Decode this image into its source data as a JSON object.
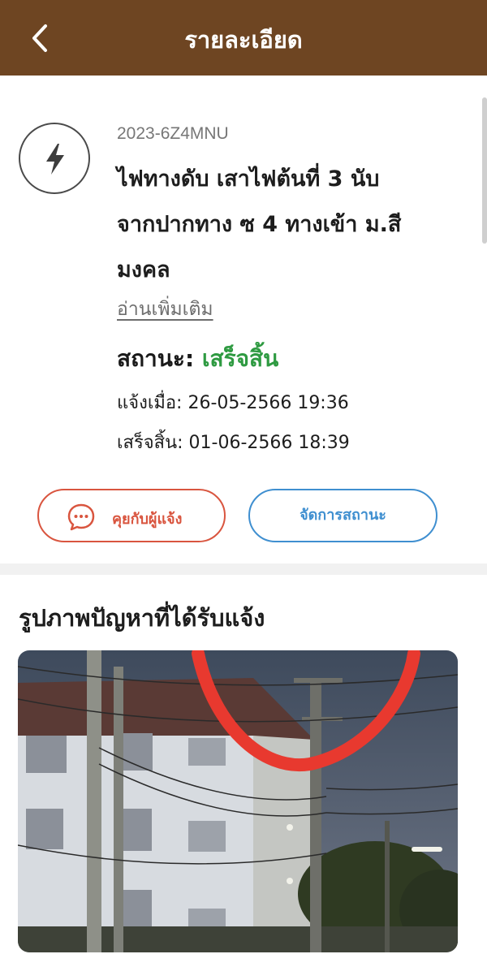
{
  "header": {
    "title": "รายละเอียด",
    "back_icon": "chevron-left-icon"
  },
  "report": {
    "category_icon": "lightning-bolt-icon",
    "ticket_id": "2023-6Z4MNU",
    "title_lines": [
      "ไฟทางดับ เสาไฟต้นที่ 3 นับ",
      "จากปากทาง ซ 4 ทางเข้า ม.สี",
      "มงคล"
    ],
    "read_more": "อ่านเพิ่มเติม",
    "status_label": "สถานะ:",
    "status_value": "เสร็จสิ้น",
    "status_color": "#2e9a41",
    "reported_label": "แจ้งเมื่อ:",
    "reported_at": "26-05-2566 19:36",
    "completed_label": "เสร็จสิ้น:",
    "completed_at": "01-06-2566 18:39"
  },
  "actions": {
    "chat_label": "คุยกับผู้แจ้ง",
    "chat_icon": "chat-bubble-icon",
    "chat_color": "#d9553f",
    "manage_label": "จัดการสถานะ",
    "manage_color": "#3f8fd0"
  },
  "photos": {
    "section_title": "รูปภาพปัญหาที่ได้รับแจ้ง"
  },
  "theme": {
    "header_bg": "#6e4522"
  }
}
